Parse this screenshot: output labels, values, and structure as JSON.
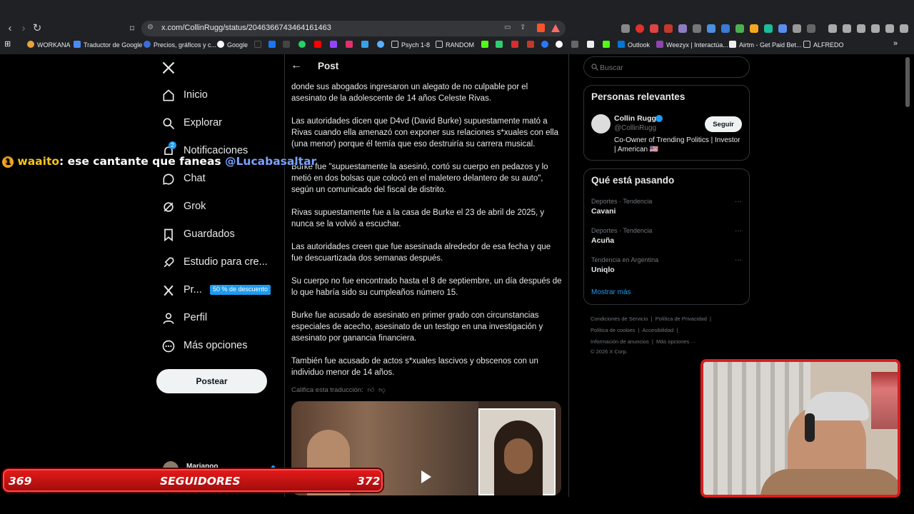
{
  "browser": {
    "url": "x.com/CollinRugg/status/2046366743464161463",
    "bookmarks": [
      "WORKANA",
      "Traductor de Google",
      "Precios, gráficos y c...",
      "Google",
      "Psych 1-8",
      "RANDOM",
      "Outlook",
      "Weezyx | Interactúa...",
      "Airtm - Get Paid Bet...",
      "ALFREDO"
    ]
  },
  "nav": {
    "items": [
      "Inicio",
      "Explorar",
      "Notificaciones",
      "Chat",
      "Grok",
      "Guardados",
      "Estudio para cre...",
      "Pr...",
      "Perfil",
      "Más opciones"
    ],
    "notif_badge": "2",
    "promo": "50 % de descuento",
    "post_button": "Postear",
    "account_name": "Marianoo"
  },
  "post": {
    "header": "Post",
    "paragraphs": [
      "donde sus abogados ingresaron un alegato de no culpable por el asesinato de la adolescente de 14 años Celeste Rivas.",
      "Las autoridades dicen que D4vd (David Burke) supuestamente mató a Rivas cuando ella amenazó con exponer sus relaciones s*xuales con ella (una menor) porque él temía que eso destruiría su carrera musical.",
      "Burke fue \"supuestamente la asesinó, cortó su cuerpo en pedazos y lo metió en dos bolsas que colocó en el maletero delantero de su auto\", según un comunicado del fiscal de distrito.",
      "Rivas supuestamente fue a la casa de Burke el 23 de abril de 2025, y nunca se la volvió a escuchar.",
      "Las autoridades creen que fue asesinada alrededor de esa fecha y que fue descuartizada dos semanas después.",
      "Su cuerpo no fue encontrado hasta el 8 de septiembre, un día después de lo que habría sido su cumpleaños número 15.",
      "Burke fue acusado de asesinato en primer grado con circunstancias especiales de acecho, asesinato de un testigo en una investigación y asesinato por ganancia financiera.",
      "También fue acusado de actos s*xuales lascivos y obscenos con un individuo menor de 14 años."
    ],
    "translation_rate": "Califica esta traducción:"
  },
  "sidebar": {
    "search_placeholder": "Buscar",
    "relevant_title": "Personas relevantes",
    "person_name": "Collin Rugg",
    "person_handle": "@CollinRugg",
    "person_bio": "Co-Owner of Trending Politics | Investor | American 🇺🇸",
    "follow_label": "Seguir",
    "trending_title": "Qué está pasando",
    "trends": [
      {
        "category": "Deportes · Tendencia",
        "name": "Cavani"
      },
      {
        "category": "Deportes · Tendencia",
        "name": "Acuña"
      },
      {
        "category": "Tendencia en Argentina",
        "name": "Uniqlo"
      }
    ],
    "show_more": "Mostrar más",
    "footer": [
      "Condiciones de Servicio",
      "Política de Privacidad",
      "Política de cookies",
      "Accesibilidad",
      "Información de anuncios",
      "Más opciones ···",
      "© 2026 X Corp."
    ]
  },
  "stream": {
    "chat_badge": "1",
    "chat_user": "waaito",
    "chat_message": ": ese cantante que faneas",
    "chat_mention": "@Lucabasaltar",
    "followers_current": "369",
    "followers_label": "SEGUIDORES",
    "followers_goal": "372"
  },
  "colors": {
    "accent": "#1d9bf0",
    "chat_user": "#f5c518",
    "mention": "#6b9bff",
    "follow_bar": "#e31919"
  }
}
